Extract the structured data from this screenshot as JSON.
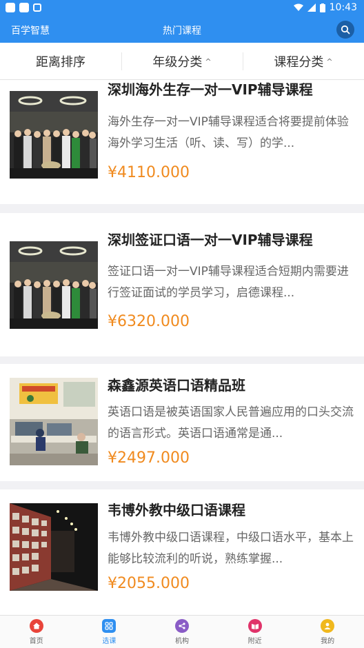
{
  "status_bar": {
    "time": "10:43"
  },
  "app_bar": {
    "app_name": "百学智慧",
    "title": "热门课程"
  },
  "filters": [
    {
      "label": "距离排序"
    },
    {
      "label": "年级分类",
      "caret": "^"
    },
    {
      "label": "课程分类",
      "caret": "^"
    }
  ],
  "courses": [
    {
      "title": "深圳海外生存一对一VIP辅导课程",
      "description": "海外生存一对一VIP辅导课程适合将要提前体验海外学习生活（听、读、写）的学...",
      "price": "¥4110.000",
      "image": "group-photo"
    },
    {
      "title": "深圳签证口语一对一VIP辅导课程",
      "description": "签证口语一对一VIP辅导课程适合短期内需要进行签证面试的学员学习，启德课程...",
      "price": "¥6320.000",
      "image": "group-photo"
    },
    {
      "title": "森鑫源英语口语精品班",
      "description": "英语口语是被英语国家人民普遍应用的口头交流的语言形式。英语口语通常是通...",
      "price": "¥2497.000",
      "image": "classroom-photo"
    },
    {
      "title": "韦博外教中级口语课程",
      "description": "韦博外教中级口语课程，中级口语水平，基本上能够比较流利的听说，熟练掌握...",
      "price": "¥2055.000",
      "image": "hallway-photo"
    }
  ],
  "tabs": [
    {
      "label": "首页",
      "icon": "home-icon",
      "color": "#e8443a"
    },
    {
      "label": "选课",
      "icon": "grid-icon",
      "color": "#2f8ff0",
      "active": true
    },
    {
      "label": "机构",
      "icon": "share-icon",
      "color": "#8a5cc6"
    },
    {
      "label": "附近",
      "icon": "book-icon",
      "color": "#e0336a"
    },
    {
      "label": "我的",
      "icon": "user-icon",
      "color": "#f0b81e"
    }
  ]
}
